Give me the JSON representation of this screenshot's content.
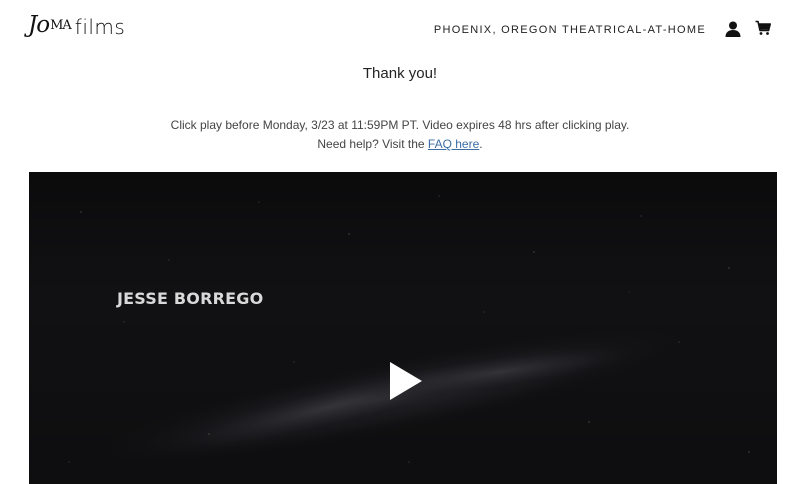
{
  "header": {
    "logo_script": "Jo",
    "logo_script_small": "MA",
    "logo_films": "films",
    "nav_link": "PHOENIX, OREGON THEATRICAL-AT-HOME",
    "account_icon": "account-icon",
    "cart_icon": "cart-icon"
  },
  "main": {
    "heading": "Thank you!",
    "info_line1": "Click play before Monday, 3/23 at 11:59PM PT. Video expires 48 hrs after clicking play.",
    "info_line2_prefix": "Need help? Visit the ",
    "faq_link": "FAQ here",
    "info_line2_suffix": "."
  },
  "video": {
    "credit_text": "JESSE BORREGO",
    "play_icon": "play-icon",
    "background_color": "#0d0d0e"
  },
  "colors": {
    "link": "#3a6ea5",
    "text": "#222222"
  }
}
